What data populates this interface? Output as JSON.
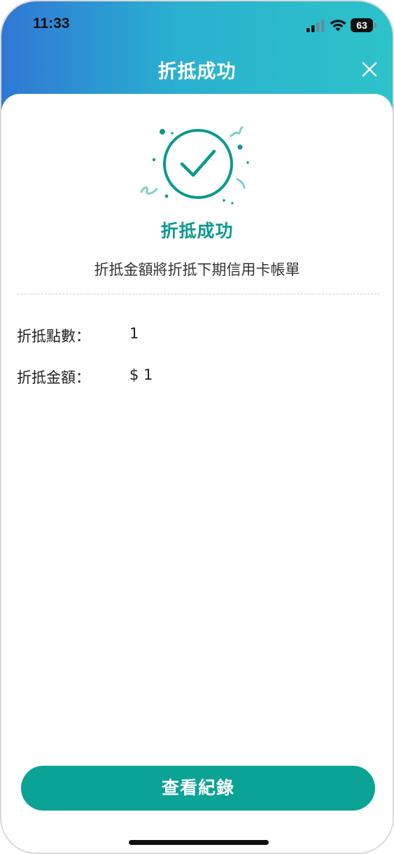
{
  "status_bar": {
    "time": "11:33",
    "battery_level": "63"
  },
  "header": {
    "title": "折抵成功",
    "close_icon": "close-icon"
  },
  "result": {
    "icon": "check-circle-icon",
    "title": "折抵成功",
    "message": "折抵金額將折抵下期信用卡帳單"
  },
  "details": [
    {
      "label": "折抵點數：",
      "value": "1"
    },
    {
      "label": "折抵金額：",
      "value": "$ 1"
    }
  ],
  "actions": {
    "view_records_label": "查看紀錄"
  },
  "colors": {
    "brand_teal": "#0aa396",
    "header_gradient_start": "#2f78d6",
    "header_gradient_end": "#2cc3c9",
    "success_text": "#0a9a8f"
  }
}
